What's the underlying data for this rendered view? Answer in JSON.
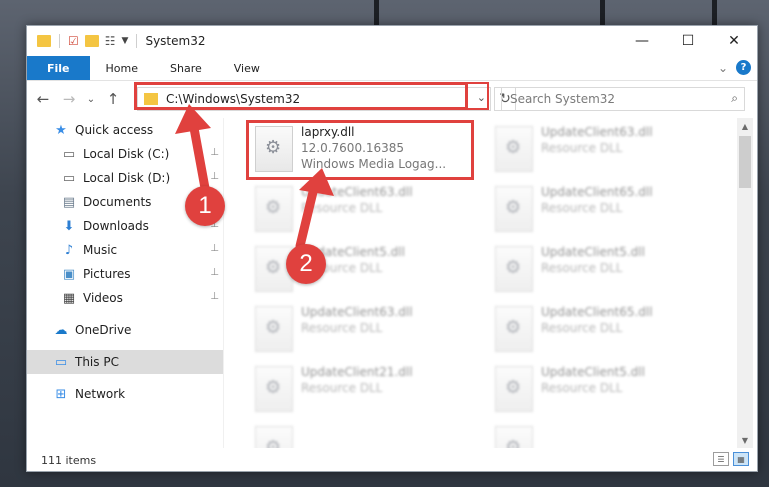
{
  "window": {
    "title": "System32",
    "controls": {
      "minimize": "—",
      "maximize": "☐",
      "close": "✕"
    }
  },
  "ribbon": {
    "tabs": [
      "File",
      "Home",
      "Share",
      "View"
    ],
    "help": "?",
    "expand": "⌄"
  },
  "nav": {
    "back": "←",
    "forward": "→",
    "recent": "⌄",
    "up": "↑",
    "address": "C:\\Windows\\System32",
    "address_dropdown": "⌄",
    "refresh": "↻",
    "search_placeholder": "Search System32",
    "search_icon": "⌕"
  },
  "sidebar": {
    "items": [
      {
        "label": "Quick access",
        "icon": "star-icon",
        "glyph": "★",
        "pinned": false
      },
      {
        "label": "Local Disk (C:)",
        "icon": "drive-icon",
        "glyph": "▭",
        "pinned": true
      },
      {
        "label": "Local Disk (D:)",
        "icon": "drive-icon",
        "glyph": "▭",
        "pinned": true
      },
      {
        "label": "Documents",
        "icon": "documents-icon",
        "glyph": "▤",
        "pinned": true
      },
      {
        "label": "Downloads",
        "icon": "downloads-icon",
        "glyph": "⬇",
        "pinned": true
      },
      {
        "label": "Music",
        "icon": "music-icon",
        "glyph": "♪",
        "pinned": true
      },
      {
        "label": "Pictures",
        "icon": "pictures-icon",
        "glyph": "▣",
        "pinned": true
      },
      {
        "label": "Videos",
        "icon": "videos-icon",
        "glyph": "▦",
        "pinned": true
      },
      {
        "label": "OneDrive",
        "icon": "cloud-icon",
        "glyph": "☁",
        "pinned": false
      },
      {
        "label": "This PC",
        "icon": "computer-icon",
        "glyph": "▭",
        "pinned": false
      },
      {
        "label": "Network",
        "icon": "network-icon",
        "glyph": "⊞",
        "pinned": false
      }
    ],
    "pin_glyph": "⊥"
  },
  "files": {
    "highlighted": {
      "name": "laprxy.dll",
      "version": "12.0.7600.16385",
      "description": "Windows Media Logag..."
    },
    "tiles": [
      {
        "name": "UpdateClient63.dll",
        "sub": "Resource DLL"
      },
      {
        "name": "UpdateClient63.dll",
        "sub": "Resource DLL"
      },
      {
        "name": "UpdateClient65.dll",
        "sub": "Resource DLL"
      },
      {
        "name": "UpdateClient5.dll",
        "sub": "Resource DLL"
      },
      {
        "name": "UpdateClient5.dll",
        "sub": "Resource DLL"
      },
      {
        "name": "UpdateClient63.dll",
        "sub": "Resource DLL"
      },
      {
        "name": "UpdateClient65.dll",
        "sub": "Resource DLL"
      },
      {
        "name": "UpdateClient21.dll",
        "sub": "Resource DLL"
      },
      {
        "name": "UpdateClient5.dll",
        "sub": "Resource DLL"
      }
    ]
  },
  "statusbar": {
    "count": "111 items"
  },
  "annotations": {
    "callout_1": "1",
    "callout_2": "2",
    "accent": "#e0413e"
  }
}
